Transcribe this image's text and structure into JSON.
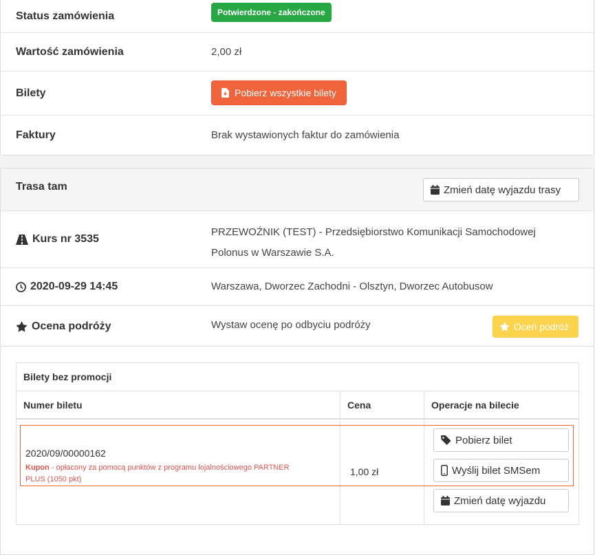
{
  "order": {
    "status_label": "Status zamówienia",
    "status_value": "Potwierdzone - zakończone",
    "value_label": "Wartość zamówienia",
    "value_value": "2,00 zł",
    "tickets_label": "Bilety",
    "download_all_button": "Pobierz wszystkie bilety",
    "invoices_label": "Faktury",
    "invoices_value": "Brak wystawionych faktur do zamówienia"
  },
  "route": {
    "title": "Trasa tam",
    "change_date_button": "Zmień datę wyjazdu trasy",
    "course_label": "Kurs nr 3535",
    "carrier_line1": "PRZEWOŹNIK (TEST) - Przedsiębiorstwo Komunikacji Samochodowej",
    "carrier_line2": "Polonus w Warszawie S.A.",
    "datetime_label": "2020-09-29 14:45",
    "route_value": "Warszawa, Dworzec Zachodni - Olsztyn, Dworzec Autobusow",
    "rating_label": "Ocena podróży",
    "rating_value": "Wystaw ocenę po odbyciu podróży",
    "rate_button": "Oceń podróż"
  },
  "tickets": {
    "caption": "Bilety bez promocji",
    "columns": [
      "Numer biletu",
      "Cena",
      "Operacje na bilecie"
    ],
    "rows": [
      {
        "number": "2020/09/00000162",
        "coupon_label": "Kupon",
        "coupon_text": " - opłacony za pomocą punktów z programu lojalnościowego PARTNER",
        "coupon_text2": "PLUS (1050 pkt)",
        "price": "1,00 zł",
        "ops": [
          "Pobierz bilet",
          "Wyślij bilet SMSem",
          "Zmień datę wyjazdu"
        ]
      }
    ]
  },
  "colors": {
    "success": "#27a844",
    "accent": "#f0643c",
    "warning": "#fcd34d",
    "coupon": "#d9534f"
  }
}
